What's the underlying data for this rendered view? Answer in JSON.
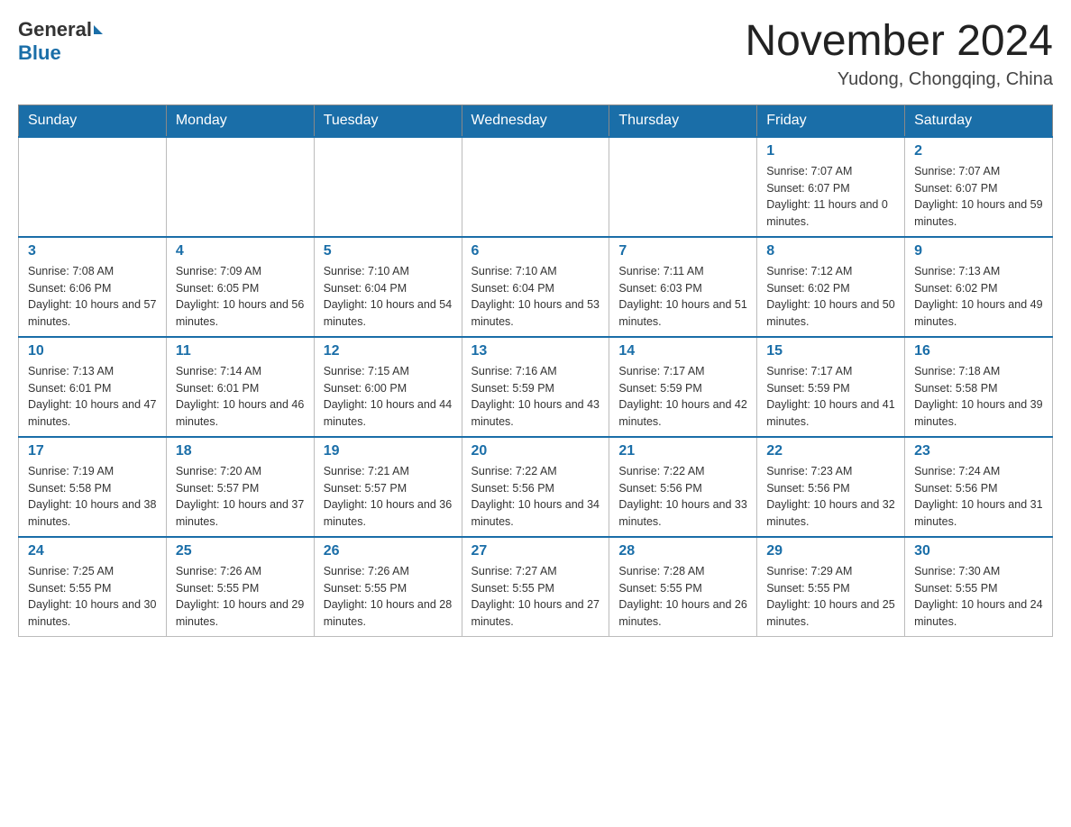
{
  "header": {
    "logo_general": "General",
    "logo_blue": "Blue",
    "month_title": "November 2024",
    "subtitle": "Yudong, Chongqing, China"
  },
  "weekdays": [
    "Sunday",
    "Monday",
    "Tuesday",
    "Wednesday",
    "Thursday",
    "Friday",
    "Saturday"
  ],
  "weeks": [
    [
      {
        "day": "",
        "info": ""
      },
      {
        "day": "",
        "info": ""
      },
      {
        "day": "",
        "info": ""
      },
      {
        "day": "",
        "info": ""
      },
      {
        "day": "",
        "info": ""
      },
      {
        "day": "1",
        "info": "Sunrise: 7:07 AM\nSunset: 6:07 PM\nDaylight: 11 hours and 0 minutes."
      },
      {
        "day": "2",
        "info": "Sunrise: 7:07 AM\nSunset: 6:07 PM\nDaylight: 10 hours and 59 minutes."
      }
    ],
    [
      {
        "day": "3",
        "info": "Sunrise: 7:08 AM\nSunset: 6:06 PM\nDaylight: 10 hours and 57 minutes."
      },
      {
        "day": "4",
        "info": "Sunrise: 7:09 AM\nSunset: 6:05 PM\nDaylight: 10 hours and 56 minutes."
      },
      {
        "day": "5",
        "info": "Sunrise: 7:10 AM\nSunset: 6:04 PM\nDaylight: 10 hours and 54 minutes."
      },
      {
        "day": "6",
        "info": "Sunrise: 7:10 AM\nSunset: 6:04 PM\nDaylight: 10 hours and 53 minutes."
      },
      {
        "day": "7",
        "info": "Sunrise: 7:11 AM\nSunset: 6:03 PM\nDaylight: 10 hours and 51 minutes."
      },
      {
        "day": "8",
        "info": "Sunrise: 7:12 AM\nSunset: 6:02 PM\nDaylight: 10 hours and 50 minutes."
      },
      {
        "day": "9",
        "info": "Sunrise: 7:13 AM\nSunset: 6:02 PM\nDaylight: 10 hours and 49 minutes."
      }
    ],
    [
      {
        "day": "10",
        "info": "Sunrise: 7:13 AM\nSunset: 6:01 PM\nDaylight: 10 hours and 47 minutes."
      },
      {
        "day": "11",
        "info": "Sunrise: 7:14 AM\nSunset: 6:01 PM\nDaylight: 10 hours and 46 minutes."
      },
      {
        "day": "12",
        "info": "Sunrise: 7:15 AM\nSunset: 6:00 PM\nDaylight: 10 hours and 44 minutes."
      },
      {
        "day": "13",
        "info": "Sunrise: 7:16 AM\nSunset: 5:59 PM\nDaylight: 10 hours and 43 minutes."
      },
      {
        "day": "14",
        "info": "Sunrise: 7:17 AM\nSunset: 5:59 PM\nDaylight: 10 hours and 42 minutes."
      },
      {
        "day": "15",
        "info": "Sunrise: 7:17 AM\nSunset: 5:59 PM\nDaylight: 10 hours and 41 minutes."
      },
      {
        "day": "16",
        "info": "Sunrise: 7:18 AM\nSunset: 5:58 PM\nDaylight: 10 hours and 39 minutes."
      }
    ],
    [
      {
        "day": "17",
        "info": "Sunrise: 7:19 AM\nSunset: 5:58 PM\nDaylight: 10 hours and 38 minutes."
      },
      {
        "day": "18",
        "info": "Sunrise: 7:20 AM\nSunset: 5:57 PM\nDaylight: 10 hours and 37 minutes."
      },
      {
        "day": "19",
        "info": "Sunrise: 7:21 AM\nSunset: 5:57 PM\nDaylight: 10 hours and 36 minutes."
      },
      {
        "day": "20",
        "info": "Sunrise: 7:22 AM\nSunset: 5:56 PM\nDaylight: 10 hours and 34 minutes."
      },
      {
        "day": "21",
        "info": "Sunrise: 7:22 AM\nSunset: 5:56 PM\nDaylight: 10 hours and 33 minutes."
      },
      {
        "day": "22",
        "info": "Sunrise: 7:23 AM\nSunset: 5:56 PM\nDaylight: 10 hours and 32 minutes."
      },
      {
        "day": "23",
        "info": "Sunrise: 7:24 AM\nSunset: 5:56 PM\nDaylight: 10 hours and 31 minutes."
      }
    ],
    [
      {
        "day": "24",
        "info": "Sunrise: 7:25 AM\nSunset: 5:55 PM\nDaylight: 10 hours and 30 minutes."
      },
      {
        "day": "25",
        "info": "Sunrise: 7:26 AM\nSunset: 5:55 PM\nDaylight: 10 hours and 29 minutes."
      },
      {
        "day": "26",
        "info": "Sunrise: 7:26 AM\nSunset: 5:55 PM\nDaylight: 10 hours and 28 minutes."
      },
      {
        "day": "27",
        "info": "Sunrise: 7:27 AM\nSunset: 5:55 PM\nDaylight: 10 hours and 27 minutes."
      },
      {
        "day": "28",
        "info": "Sunrise: 7:28 AM\nSunset: 5:55 PM\nDaylight: 10 hours and 26 minutes."
      },
      {
        "day": "29",
        "info": "Sunrise: 7:29 AM\nSunset: 5:55 PM\nDaylight: 10 hours and 25 minutes."
      },
      {
        "day": "30",
        "info": "Sunrise: 7:30 AM\nSunset: 5:55 PM\nDaylight: 10 hours and 24 minutes."
      }
    ]
  ]
}
